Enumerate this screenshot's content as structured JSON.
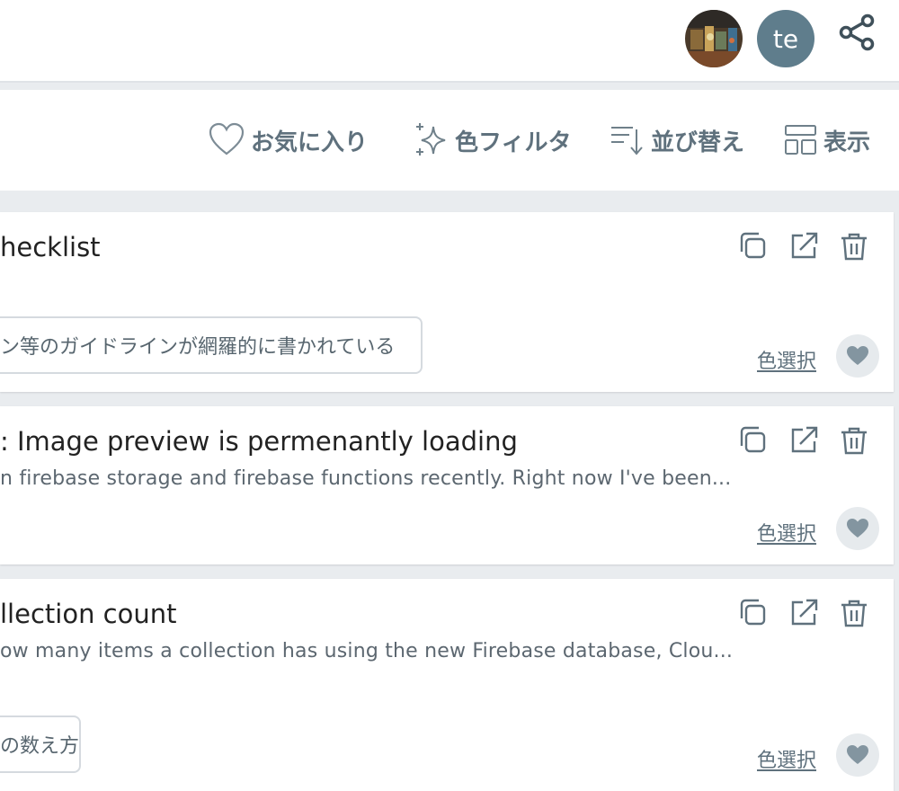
{
  "header": {
    "avatar_initials": "te",
    "share_icon": "share-icon"
  },
  "toolbar": {
    "favorites_label": "お気に入り",
    "color_filter_label": "色フィルタ",
    "sort_label": "並び替え",
    "view_label": "表示"
  },
  "cards": [
    {
      "title": "hecklist",
      "description": "",
      "tag": "ン等のガイドラインが網羅的に書かれている",
      "color_link": "色選択"
    },
    {
      "title": ": Image preview is permenantly loading",
      "description": "n firebase storage and firebase functions recently. Right now I've been...",
      "tag": "",
      "color_link": "色選択"
    },
    {
      "title": "llection count",
      "description": "ow many items a collection has using the new Firebase database, Clou...",
      "tag": "の数え方",
      "color_link": "色選択"
    }
  ],
  "colors": {
    "accent": "#5f717d",
    "avatar_bg": "#5f7d8c",
    "background": "#e9ecef"
  }
}
